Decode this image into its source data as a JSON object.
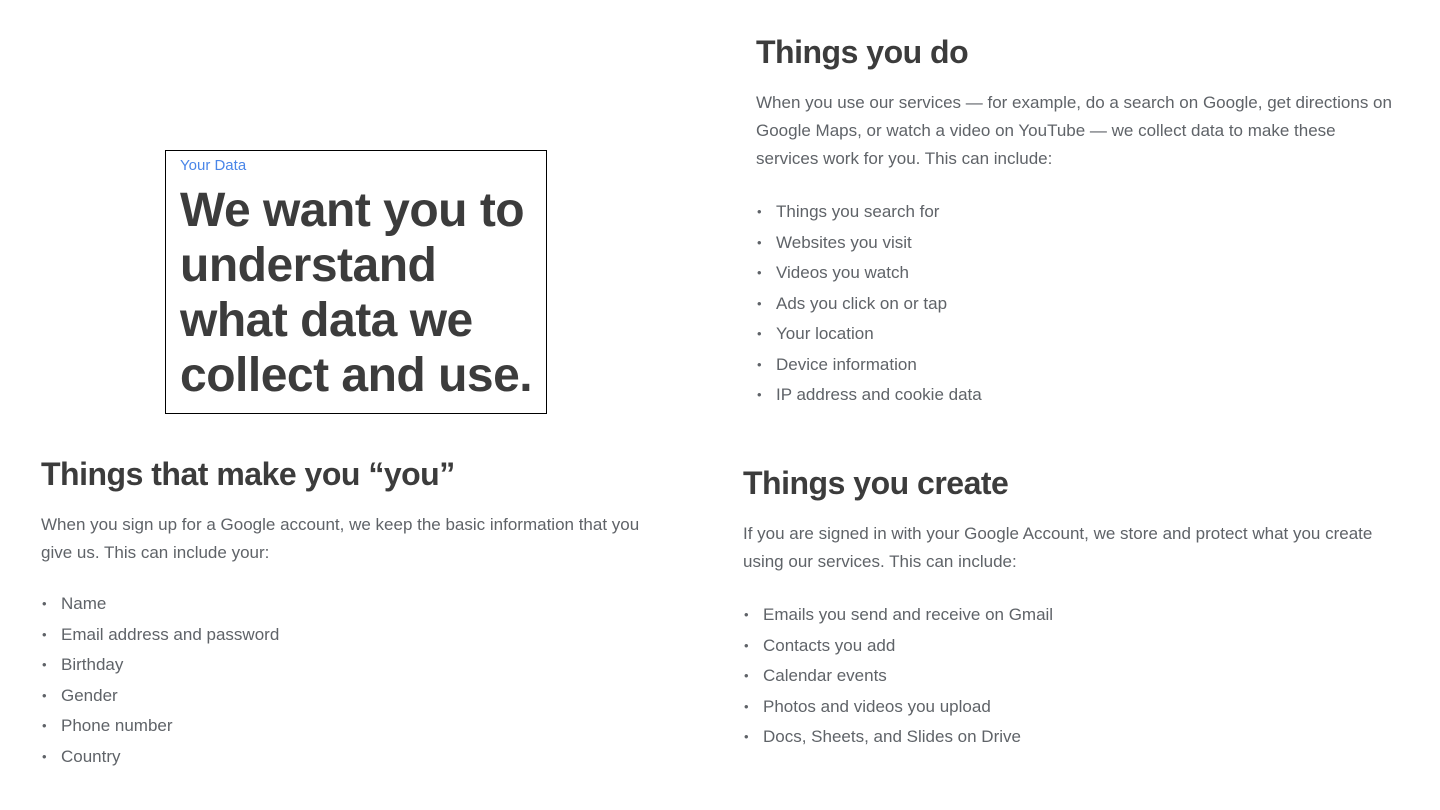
{
  "hero": {
    "eyebrow": "Your Data",
    "title": "We want you to understand what data we collect and use."
  },
  "things_you": {
    "heading": "Things that make you “you”",
    "intro": "When you sign up for a Google account, we keep the basic information that you give us. This can include your:",
    "items": [
      "Name",
      "Email address and password",
      "Birthday",
      "Gender",
      "Phone number",
      "Country"
    ]
  },
  "things_do": {
    "heading": "Things you do",
    "intro": "When you use our services — for example, do a search on Google, get directions on Google Maps, or watch a video on YouTube — we collect data to make these services work for you. This can include:",
    "items": [
      "Things you search for",
      "Websites you visit",
      "Videos you watch",
      "Ads you click on or tap",
      "Your location",
      "Device information",
      "IP address and cookie data"
    ]
  },
  "things_create": {
    "heading": "Things you create",
    "intro": "If you are signed in with your Google Account, we store and protect what you create using our services. This can include:",
    "items": [
      "Emails you send and receive on Gmail",
      "Contacts you add",
      "Calendar events",
      "Photos and videos you upload",
      "Docs, Sheets, and Slides on Drive"
    ]
  },
  "colors": {
    "eyebrow": "#4a86e8",
    "heading": "#3c3c3c",
    "body": "#5f6368"
  }
}
